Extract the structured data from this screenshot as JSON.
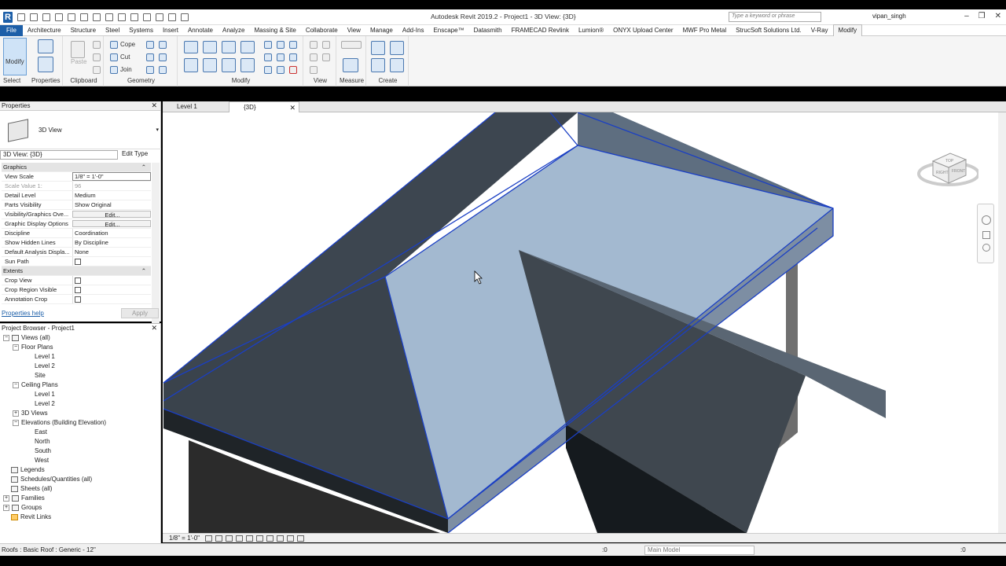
{
  "app": {
    "title": "Autodesk Revit 2019.2 - Project1 - 3D View: {3D}",
    "search_placeholder": "Type a keyword or phrase",
    "user": "vipan_singh"
  },
  "ribbon_tabs": [
    "File",
    "Architecture",
    "Structure",
    "Steel",
    "Systems",
    "Insert",
    "Annotate",
    "Analyze",
    "Massing & Site",
    "Collaborate",
    "View",
    "Manage",
    "Add-Ins",
    "Enscape™",
    "Datasmith",
    "FRAMECAD Revlink",
    "Lumion®",
    "ONYX Upload Center",
    "MWF Pro Metal",
    "StrucSoft Solutions Ltd.",
    "V-Ray",
    "Modify"
  ],
  "ribbon": {
    "modify_label": "Modify",
    "select_label": "Select",
    "properties_label": "Properties",
    "paste_label": "Paste",
    "clipboard_label": "Clipboard",
    "cope_label": "Cope",
    "cut_label": "Cut",
    "join_label": "Join",
    "geometry_label": "Geometry",
    "modify_group_label": "Modify",
    "view_label": "View",
    "measure_label": "Measure",
    "create_label": "Create"
  },
  "properties": {
    "header": "Properties",
    "type_name": "3D View",
    "instance_selector": "3D View: {3D}",
    "edit_type": "Edit Type",
    "categories": {
      "graphics": "Graphics",
      "extents": "Extents"
    },
    "rows": [
      {
        "k": "View Scale",
        "v": "1/8\" = 1'-0\""
      },
      {
        "k": "Scale Value    1:",
        "v": "96"
      },
      {
        "k": "Detail Level",
        "v": "Medium"
      },
      {
        "k": "Parts Visibility",
        "v": "Show Original"
      },
      {
        "k": "Visibility/Graphics Ove...",
        "v": "Edit..."
      },
      {
        "k": "Graphic Display Options",
        "v": "Edit..."
      },
      {
        "k": "Discipline",
        "v": "Coordination"
      },
      {
        "k": "Show Hidden Lines",
        "v": "By Discipline"
      },
      {
        "k": "Default Analysis Displa...",
        "v": "None"
      },
      {
        "k": "Sun Path",
        "v": ""
      }
    ],
    "extent_rows": [
      {
        "k": "Crop View"
      },
      {
        "k": "Crop Region Visible"
      },
      {
        "k": "Annotation Crop"
      }
    ],
    "help_link": "Properties help",
    "apply": "Apply"
  },
  "browser": {
    "header": "Project Browser - Project1",
    "views_all": "Views (all)",
    "floor_plans": "Floor Plans",
    "fp_level1": "Level 1",
    "fp_level2": "Level 2",
    "fp_site": "Site",
    "ceiling_plans": "Ceiling Plans",
    "cp_level1": "Level 1",
    "cp_level2": "Level 2",
    "views_3d": "3D Views",
    "elevations": "Elevations (Building Elevation)",
    "east": "East",
    "north": "North",
    "south": "South",
    "west": "West",
    "legends": "Legends",
    "schedules": "Schedules/Quantities (all)",
    "sheets": "Sheets (all)",
    "families": "Families",
    "groups": "Groups",
    "revit_links": "Revit Links"
  },
  "view_tabs": {
    "tab1": "Level 1",
    "tab2": "{3D}"
  },
  "viewcube": {
    "top": "TOP",
    "front": "FRONT",
    "right": "RIGHT"
  },
  "view_control": {
    "scale": "1/8\" = 1'-0\""
  },
  "status": {
    "text": "Roofs : Basic Roof : Generic - 12\"",
    "workset_count": ":0",
    "model": "Main Model",
    "filter_count": ":0"
  },
  "colors": {
    "selection_blue": "#1a3fc4",
    "selected_fill": "#9fb6cf",
    "roof_dark": "#2e343b",
    "revit_blue": "#1d5fa8"
  }
}
